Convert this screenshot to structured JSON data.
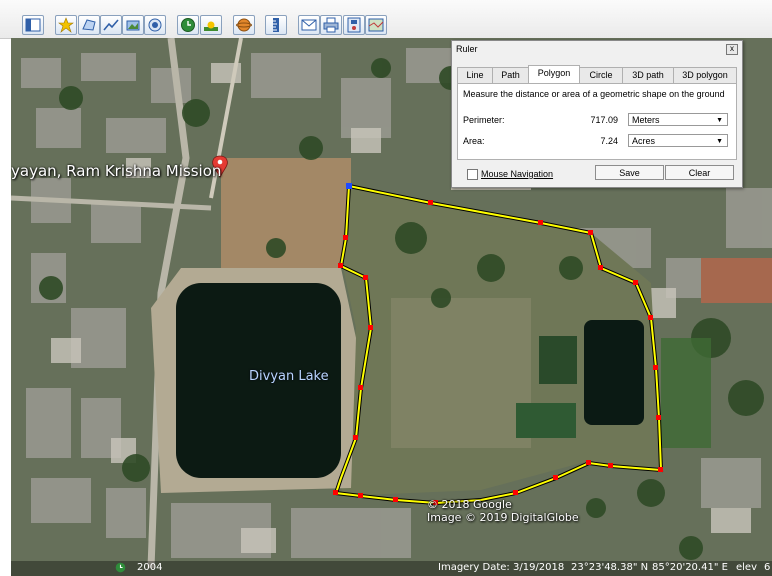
{
  "map": {
    "place_label": "yayan, Ram Krishna Mission",
    "lake_label": "Divyan Lake",
    "copyright": [
      "© 2018 Google",
      "Image © 2019 DigitalGlobe"
    ],
    "status": {
      "year": "2004",
      "imagery_date": "Imagery Date: 3/19/2018",
      "latitude": "23°23'48.38\" N",
      "longitude": "85°20'20.41\" E",
      "elev": "elev",
      "trailing": "6"
    },
    "accent_line_color": "#ffff00",
    "vertex_color": "#ff0000"
  },
  "ruler": {
    "title": "Ruler",
    "close_label": "x",
    "tabs": [
      {
        "label": "Line"
      },
      {
        "label": "Path"
      },
      {
        "label": "Polygon"
      },
      {
        "label": "Circle"
      },
      {
        "label": "3D path"
      },
      {
        "label": "3D polygon"
      }
    ],
    "active_tab": "Polygon",
    "description": "Measure the distance or area of a geometric shape on the ground",
    "perimeter": {
      "label": "Perimeter:",
      "value": "717.09",
      "unit": "Meters"
    },
    "area": {
      "label": "Area:",
      "value": "7.24",
      "unit": "Acres"
    },
    "mouse_navigation": "Mouse Navigation",
    "save_label": "Save",
    "clear_label": "Clear"
  },
  "toolbar_icons": [
    "sidebar-toggle-icon",
    "placemark-icon",
    "polygon-icon",
    "path-icon",
    "overlay-icon",
    "record-tour-icon",
    "historical-imagery-icon",
    "sunlight-icon",
    "switch-planet-icon",
    "ruler-icon",
    "email-icon",
    "print-icon",
    "save-image-icon",
    "view-in-maps-icon"
  ]
}
